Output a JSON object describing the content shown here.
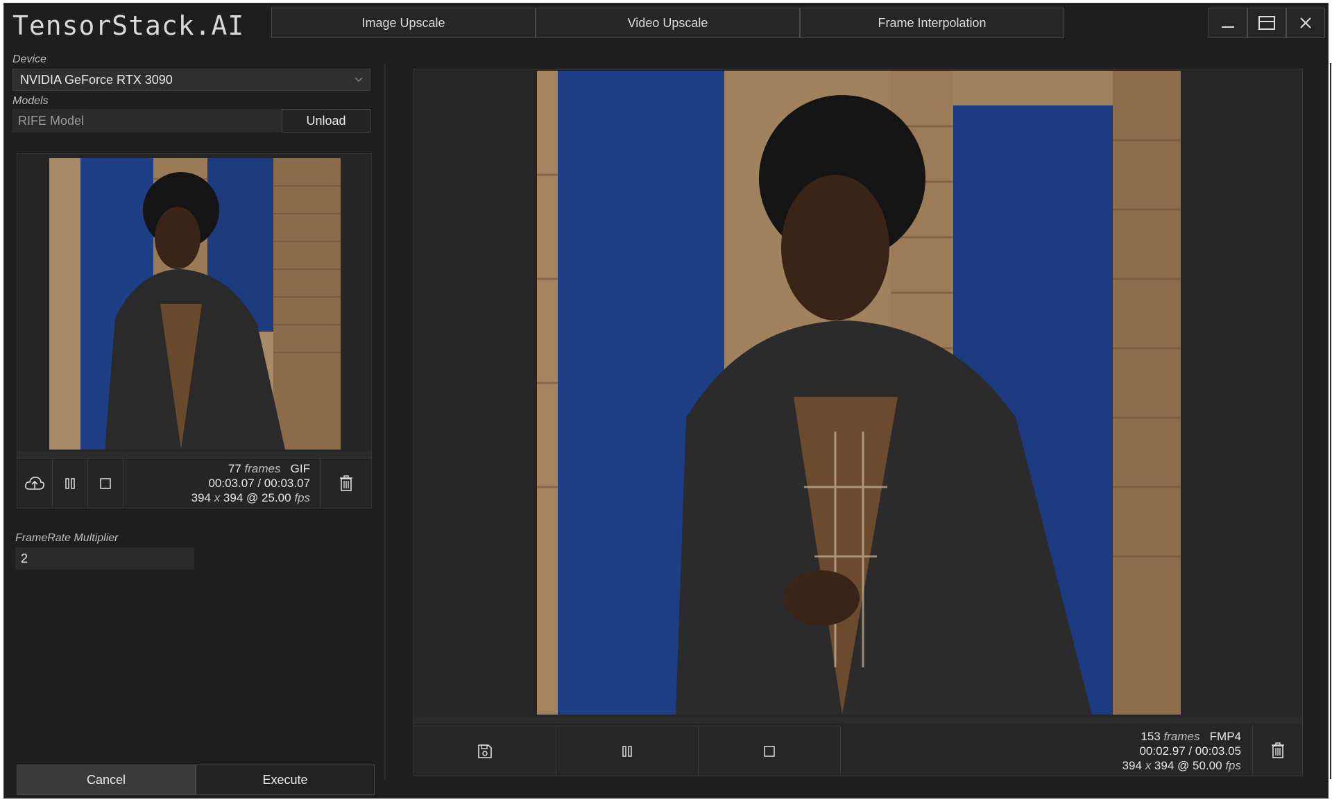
{
  "app": {
    "title": "TensorStack.AI"
  },
  "tabs": [
    {
      "label": "Image Upscale"
    },
    {
      "label": "Video Upscale"
    },
    {
      "label": "Frame Interpolation"
    }
  ],
  "device": {
    "label": "Device",
    "value": "NVIDIA GeForce RTX 3090"
  },
  "models": {
    "label": "Models",
    "placeholder": "RIFE Model",
    "unload_label": "Unload"
  },
  "input_media": {
    "frames": "77",
    "frames_unit": "frames",
    "format": "GIF",
    "time": "00:03.07 / 00:03.07",
    "width": "394",
    "height": "394",
    "x": "x",
    "fps": "25.00",
    "fps_unit": "fps",
    "at": "@"
  },
  "multiplier": {
    "label": "FrameRate Multiplier",
    "value": "2"
  },
  "actions": {
    "cancel_label": "Cancel",
    "execute_label": "Execute"
  },
  "output_media": {
    "frames": "153",
    "frames_unit": "frames",
    "format": "FMP4",
    "time": "00:02.97 / 00:03.05",
    "width": "394",
    "height": "394",
    "x": "x",
    "fps": "50.00",
    "fps_unit": "fps",
    "at": "@"
  },
  "colors": {
    "background": "#1e1e1e",
    "panel": "#262626",
    "accent_blue": "#1f3f83"
  }
}
